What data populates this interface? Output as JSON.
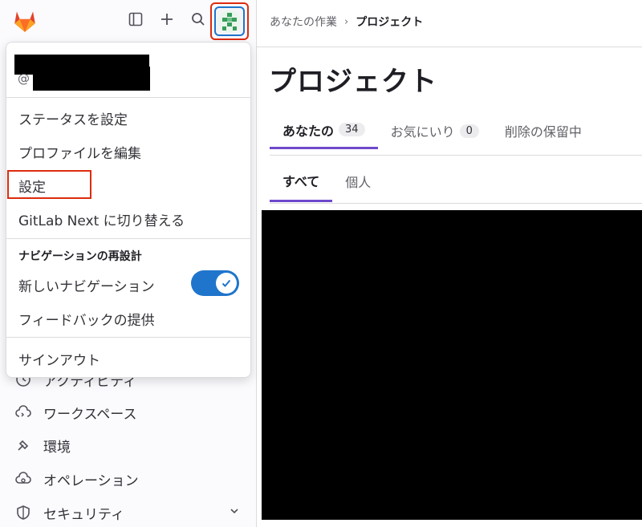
{
  "breadcrumb": {
    "parent": "あなたの作業",
    "current": "プロジェクト"
  },
  "page": {
    "title": "プロジェクト"
  },
  "tabs": [
    {
      "label": "あなたの",
      "count": "34"
    },
    {
      "label": "お気にいり",
      "count": "0"
    },
    {
      "label": "削除の保留中"
    }
  ],
  "subtabs": [
    {
      "label": "すべて"
    },
    {
      "label": "個人"
    }
  ],
  "user_menu": {
    "handle_prefix": "@",
    "items": {
      "set_status": "ステータスを設定",
      "edit_profile": "プロファイルを編集",
      "settings": "設定",
      "switch_next": "GitLab Next に切り替える",
      "nav_redesign_heading": "ナビゲーションの再設計",
      "new_navigation": "新しいナビゲーション",
      "feedback": "フィードバックの提供",
      "sign_out": "サインアウト"
    },
    "new_navigation_enabled": true
  },
  "sidebar": {
    "items": [
      {
        "label": "アクティビティ",
        "icon": "history-icon"
      },
      {
        "label": "ワークスペース",
        "icon": "cloud-terminal-icon"
      },
      {
        "label": "環境",
        "icon": "environment-icon"
      },
      {
        "label": "オペレーション",
        "icon": "cloud-gear-icon"
      },
      {
        "label": "セキュリティ",
        "icon": "shield-icon"
      }
    ]
  },
  "colors": {
    "accent": "#6e49cb",
    "toggle": "#1f75cb",
    "highlight": "#dd2b0e"
  }
}
